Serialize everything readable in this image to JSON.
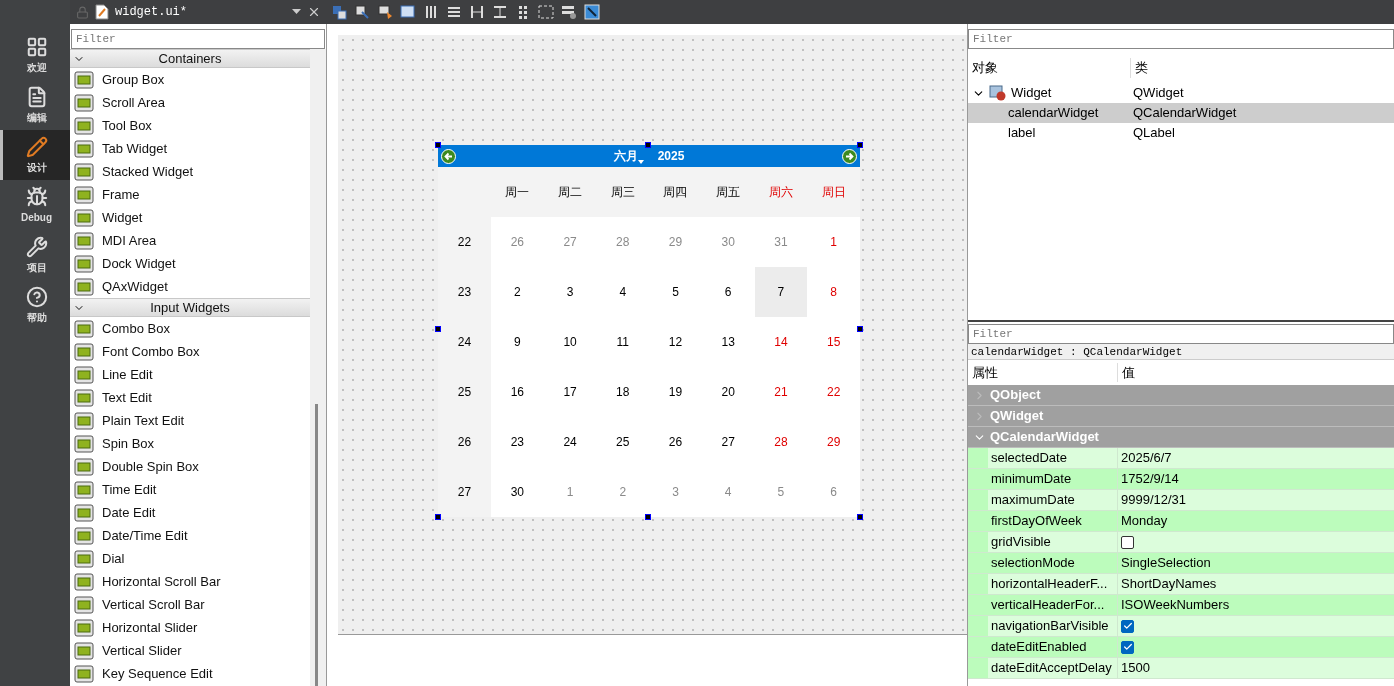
{
  "nav": [
    {
      "label": "欢迎",
      "kind": "grid",
      "selected": false
    },
    {
      "label": "编辑",
      "kind": "doc",
      "selected": false
    },
    {
      "label": "设计",
      "kind": "pencil",
      "selected": true
    },
    {
      "label": "Debug",
      "kind": "bug",
      "selected": false
    },
    {
      "label": "项目",
      "kind": "wrench",
      "selected": false
    },
    {
      "label": "帮助",
      "kind": "help",
      "selected": false
    }
  ],
  "toolbar": {
    "file": "widget.ui*"
  },
  "widget_box": {
    "filter_placeholder": "Filter",
    "groups": [
      {
        "title": "Containers",
        "expanded": true,
        "items": [
          "Group Box",
          "Scroll Area",
          "Tool Box",
          "Tab Widget",
          "Stacked Widget",
          "Frame",
          "Widget",
          "MDI Area",
          "Dock Widget",
          "QAxWidget"
        ]
      },
      {
        "title": "Input Widgets",
        "expanded": true,
        "items": [
          "Combo Box",
          "Font Combo Box",
          "Line Edit",
          "Text Edit",
          "Plain Text Edit",
          "Spin Box",
          "Double Spin Box",
          "Time Edit",
          "Date Edit",
          "Date/Time Edit",
          "Dial",
          "Horizontal Scroll Bar",
          "Vertical Scroll Bar",
          "Horizontal Slider",
          "Vertical Slider",
          "Key Sequence Edit"
        ]
      }
    ]
  },
  "calendar": {
    "month": "六月",
    "year": "2025",
    "headers": [
      {
        "text": "周一",
        "weekend": false
      },
      {
        "text": "周二",
        "weekend": false
      },
      {
        "text": "周三",
        "weekend": false
      },
      {
        "text": "周四",
        "weekend": false
      },
      {
        "text": "周五",
        "weekend": false
      },
      {
        "text": "周六",
        "weekend": true
      },
      {
        "text": "周日",
        "weekend": true
      }
    ],
    "weeks": [
      {
        "week": "22",
        "days": [
          {
            "text": "26",
            "other_month": true,
            "selected": false
          },
          {
            "text": "27",
            "other_month": true,
            "selected": false
          },
          {
            "text": "28",
            "other_month": true,
            "selected": false
          },
          {
            "text": "29",
            "other_month": true,
            "selected": false
          },
          {
            "text": "30",
            "other_month": true,
            "selected": false
          },
          {
            "text": "31",
            "other_month": true,
            "selected": false
          },
          {
            "text": "1",
            "other_month": false,
            "selected": false
          }
        ]
      },
      {
        "week": "23",
        "days": [
          {
            "text": "2",
            "other_month": false,
            "selected": false
          },
          {
            "text": "3",
            "other_month": false,
            "selected": false
          },
          {
            "text": "4",
            "other_month": false,
            "selected": false
          },
          {
            "text": "5",
            "other_month": false,
            "selected": false
          },
          {
            "text": "6",
            "other_month": false,
            "selected": false
          },
          {
            "text": "7",
            "other_month": false,
            "selected": true
          },
          {
            "text": "8",
            "other_month": false,
            "selected": false
          }
        ]
      },
      {
        "week": "24",
        "days": [
          {
            "text": "9",
            "other_month": false,
            "selected": false
          },
          {
            "text": "10",
            "other_month": false,
            "selected": false
          },
          {
            "text": "11",
            "other_month": false,
            "selected": false
          },
          {
            "text": "12",
            "other_month": false,
            "selected": false
          },
          {
            "text": "13",
            "other_month": false,
            "selected": false
          },
          {
            "text": "14",
            "other_month": false,
            "selected": false
          },
          {
            "text": "15",
            "other_month": false,
            "selected": false
          }
        ]
      },
      {
        "week": "25",
        "days": [
          {
            "text": "16",
            "other_month": false,
            "selected": false
          },
          {
            "text": "17",
            "other_month": false,
            "selected": false
          },
          {
            "text": "18",
            "other_month": false,
            "selected": false
          },
          {
            "text": "19",
            "other_month": false,
            "selected": false
          },
          {
            "text": "20",
            "other_month": false,
            "selected": false
          },
          {
            "text": "21",
            "other_month": false,
            "selected": false
          },
          {
            "text": "22",
            "other_month": false,
            "selected": false
          }
        ]
      },
      {
        "week": "26",
        "days": [
          {
            "text": "23",
            "other_month": false,
            "selected": false
          },
          {
            "text": "24",
            "other_month": false,
            "selected": false
          },
          {
            "text": "25",
            "other_month": false,
            "selected": false
          },
          {
            "text": "26",
            "other_month": false,
            "selected": false
          },
          {
            "text": "27",
            "other_month": false,
            "selected": false
          },
          {
            "text": "28",
            "other_month": false,
            "selected": false
          },
          {
            "text": "29",
            "other_month": false,
            "selected": false
          }
        ]
      },
      {
        "week": "27",
        "days": [
          {
            "text": "30",
            "other_month": false,
            "selected": false
          },
          {
            "text": "1",
            "other_month": true,
            "selected": false
          },
          {
            "text": "2",
            "other_month": true,
            "selected": false
          },
          {
            "text": "3",
            "other_month": true,
            "selected": false
          },
          {
            "text": "4",
            "other_month": true,
            "selected": false
          },
          {
            "text": "5",
            "other_month": true,
            "selected": false
          },
          {
            "text": "6",
            "other_month": true,
            "selected": false
          }
        ]
      }
    ]
  },
  "object_inspector": {
    "filter_placeholder": "Filter",
    "columns": [
      "对象",
      "类"
    ],
    "tree": [
      {
        "name": "Widget",
        "class": "QWidget",
        "expanded": true,
        "selected": false,
        "children": [
          {
            "name": "calendarWidget",
            "class": "QCalendarWidget",
            "selected": true
          },
          {
            "name": "label",
            "class": "QLabel",
            "selected": false
          }
        ]
      }
    ]
  },
  "property_editor": {
    "filter_placeholder": "Filter",
    "object_label": "calendarWidget : QCalendarWidget",
    "columns": [
      "属性",
      "值"
    ],
    "groups": [
      {
        "title": "QObject",
        "expanded": false
      },
      {
        "title": "QWidget",
        "expanded": false
      },
      {
        "title": "QCalendarWidget",
        "expanded": true,
        "properties": [
          {
            "name": "selectedDate",
            "kind": "text",
            "value": "2025/6/7"
          },
          {
            "name": "minimumDate",
            "kind": "text",
            "value": "1752/9/14"
          },
          {
            "name": "maximumDate",
            "kind": "text",
            "value": "9999/12/31"
          },
          {
            "name": "firstDayOfWeek",
            "kind": "text",
            "value": "Monday"
          },
          {
            "name": "gridVisible",
            "kind": "checkbox",
            "checked": false
          },
          {
            "name": "selectionMode",
            "kind": "text",
            "value": "SingleSelection"
          },
          {
            "name": "horizontalHeaderF...",
            "kind": "text",
            "value": "ShortDayNames"
          },
          {
            "name": "verticalHeaderFor...",
            "kind": "text",
            "value": "ISOWeekNumbers"
          },
          {
            "name": "navigationBarVisible",
            "kind": "checkbox",
            "checked": true
          },
          {
            "name": "dateEditEnabled",
            "kind": "checkbox",
            "checked": true
          },
          {
            "name": "dateEditAcceptDelay",
            "kind": "text",
            "value": "1500"
          }
        ]
      }
    ]
  }
}
